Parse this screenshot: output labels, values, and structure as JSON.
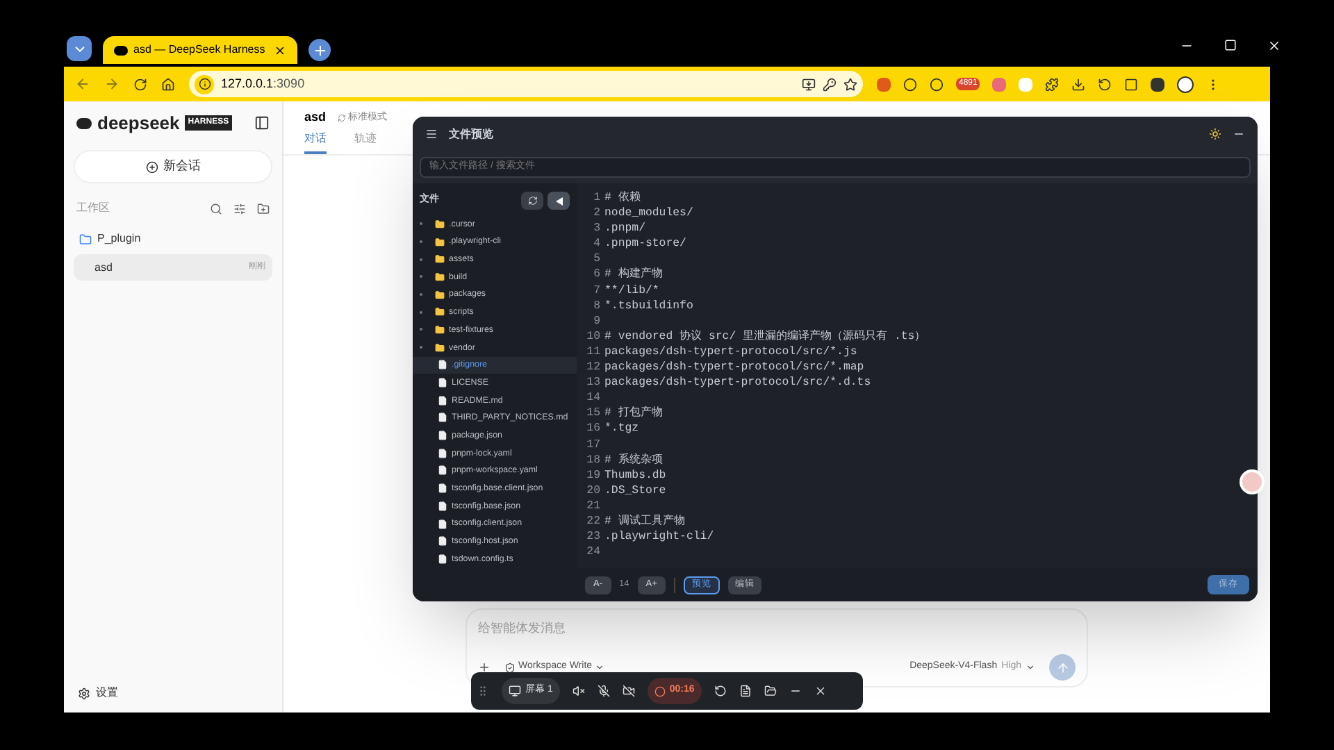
{
  "browser": {
    "tab_title": "asd — DeepSeek Harness",
    "url_host": "127.0.0.1",
    "url_port": ":3090",
    "extension_badge": "4891"
  },
  "sidebar": {
    "logo_text": "deepseek",
    "logo_badge": "HARNESS",
    "new_chat": "新会话",
    "section": "工作区",
    "project": "P_plugin",
    "sessions": [
      {
        "title": "asd",
        "time": "刚刚",
        "selected": true
      }
    ],
    "settings": "设置"
  },
  "header": {
    "title": "asd",
    "mode": "标准模式",
    "tabs": [
      {
        "label": "对话",
        "selected": true
      },
      {
        "label": "轨迹",
        "selected": false
      }
    ]
  },
  "composer": {
    "placeholder": "给智能体发消息",
    "permission": "Workspace Write",
    "model": "DeepSeek-V4-Flash",
    "effort": "High"
  },
  "preview": {
    "title": "文件预览",
    "search_placeholder": "输入文件路径 / 搜索文件",
    "files_label": "文件",
    "tree": [
      {
        "name": ".cursor",
        "kind": "folder",
        "selected": false
      },
      {
        "name": ".playwright-cli",
        "kind": "folder",
        "selected": false
      },
      {
        "name": "assets",
        "kind": "folder",
        "selected": false
      },
      {
        "name": "build",
        "kind": "folder",
        "selected": false
      },
      {
        "name": "packages",
        "kind": "folder",
        "selected": false
      },
      {
        "name": "scripts",
        "kind": "folder",
        "selected": false
      },
      {
        "name": "test-fixtures",
        "kind": "folder",
        "selected": false
      },
      {
        "name": "vendor",
        "kind": "folder",
        "selected": false
      },
      {
        "name": ".gitignore",
        "kind": "file",
        "selected": true
      },
      {
        "name": "LICENSE",
        "kind": "file",
        "selected": false
      },
      {
        "name": "README.md",
        "kind": "file",
        "selected": false
      },
      {
        "name": "THIRD_PARTY_NOTICES.md",
        "kind": "file",
        "selected": false
      },
      {
        "name": "package.json",
        "kind": "file",
        "selected": false
      },
      {
        "name": "pnpm-lock.yaml",
        "kind": "file",
        "selected": false
      },
      {
        "name": "pnpm-workspace.yaml",
        "kind": "file",
        "selected": false
      },
      {
        "name": "tsconfig.base.client.json",
        "kind": "file",
        "selected": false
      },
      {
        "name": "tsconfig.base.json",
        "kind": "file",
        "selected": false
      },
      {
        "name": "tsconfig.client.json",
        "kind": "file",
        "selected": false
      },
      {
        "name": "tsconfig.host.json",
        "kind": "file",
        "selected": false
      },
      {
        "name": "tsdown.config.ts",
        "kind": "file",
        "selected": false
      }
    ],
    "lines": [
      {
        "n": "1",
        "text": "# 依赖"
      },
      {
        "n": "2",
        "text": "node_modules/"
      },
      {
        "n": "3",
        "text": ".pnpm/"
      },
      {
        "n": "4",
        "text": ".pnpm-store/"
      },
      {
        "n": "5"
      },
      {
        "n": "6",
        "text": "# 构建产物"
      },
      {
        "n": "7",
        "text": "**/lib/*"
      },
      {
        "n": "8",
        "text": "*.tsbuildinfo"
      },
      {
        "n": "9"
      },
      {
        "n": "10",
        "text": "# vendored 协议 src/ 里泄漏的编译产物（源码只有 .ts）"
      },
      {
        "n": "11",
        "text": "packages/dsh-typert-protocol/src/*.js"
      },
      {
        "n": "12",
        "text": "packages/dsh-typert-protocol/src/*.map"
      },
      {
        "n": "13",
        "text": "packages/dsh-typert-protocol/src/*.d.ts"
      },
      {
        "n": "14"
      },
      {
        "n": "15",
        "text": "# 打包产物"
      },
      {
        "n": "16",
        "text": "*.tgz"
      },
      {
        "n": "17"
      },
      {
        "n": "18",
        "text": "# 系统杂项"
      },
      {
        "n": "19",
        "text": "Thumbs.db"
      },
      {
        "n": "20",
        "text": ".DS_Store"
      },
      {
        "n": "21"
      },
      {
        "n": "22",
        "text": "# 调试工具产物"
      },
      {
        "n": "23",
        "text": ".playwright-cli/"
      },
      {
        "n": "24"
      }
    ],
    "font_down": "A-",
    "font_size": "14",
    "font_up": "A+",
    "modes": [
      {
        "label": "预览",
        "selected": true
      },
      {
        "label": "编辑",
        "selected": false
      }
    ],
    "save": "保存"
  },
  "recorder": {
    "screen": "屏幕 1",
    "timer": "00:16"
  }
}
